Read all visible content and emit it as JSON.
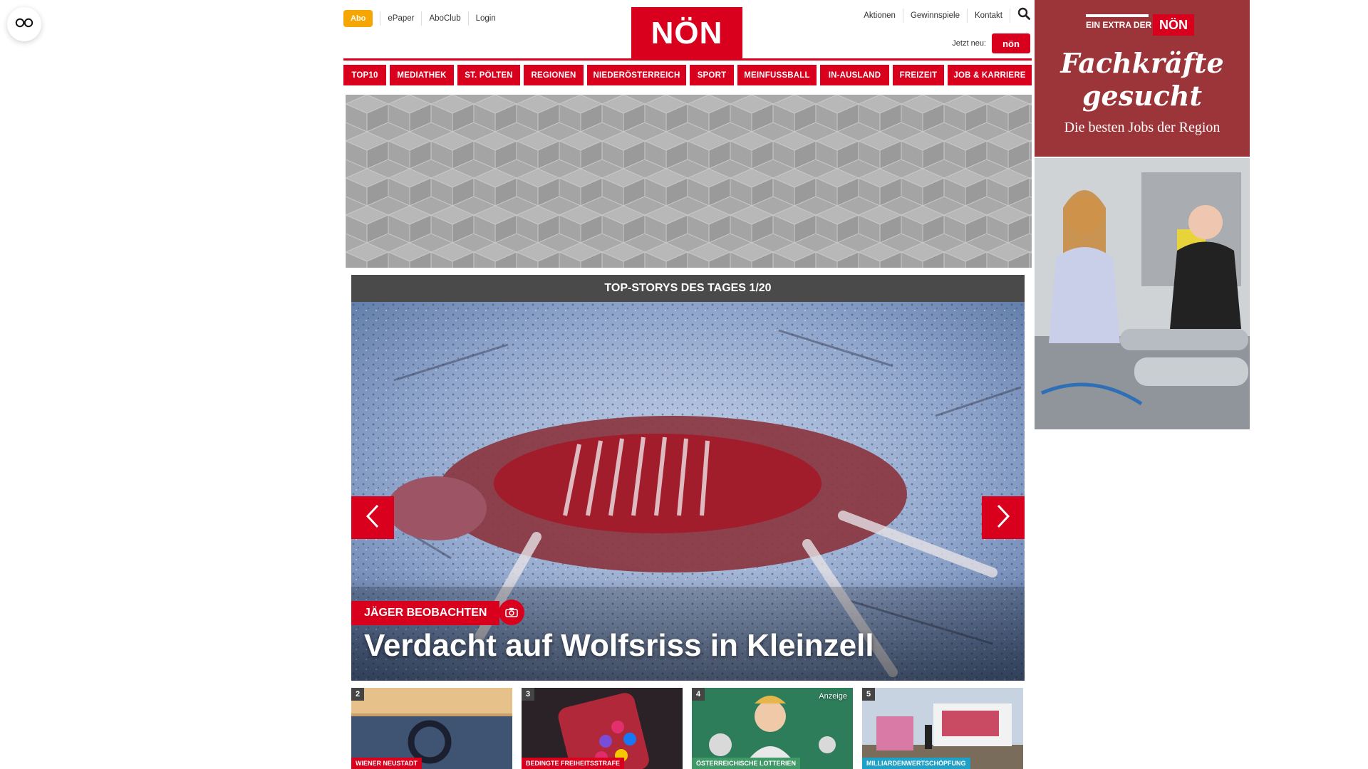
{
  "reader": {
    "icon": "glasses-icon"
  },
  "header": {
    "abo_label": "Abo",
    "left_links": [
      "ePaper",
      "AboClub",
      "Login"
    ],
    "logo_text": "NÖN",
    "right_links": [
      "Aktionen",
      "Gewinnspiele",
      "Kontakt"
    ],
    "search_icon": "search-icon",
    "jetzt_label": "Jetzt neu:",
    "mini_logo_text": "nön",
    "brand_color": "#d9001e",
    "abo_color": "#f5a600"
  },
  "mainnav": [
    "TOP10",
    "MEDIATHEK",
    "ST. PÖLTEN",
    "REGIONEN",
    "NIEDERÖSTERREICH",
    "SPORT",
    "MEINFUSSBALL",
    "IN-AUSLAND",
    "FREIZEIT",
    "JOB & KARRIERE"
  ],
  "slider": {
    "heading": "TOP-STORYS DES TAGES 1/20",
    "kicker": "JÄGER BEOBACHTEN",
    "headline": "Verdacht auf Wolfsriss in Kleinzell",
    "prev_icon": "chevron-left-icon",
    "next_icon": "chevron-right-icon",
    "camera_icon": "camera-icon"
  },
  "teasers": [
    {
      "num": "2",
      "tag": "WIENER NEUSTADT",
      "anzeige": ""
    },
    {
      "num": "3",
      "tag": "BEDINGTE FREIHEITSSTRAFE",
      "anzeige": ""
    },
    {
      "num": "4",
      "tag": "ÖSTERREICHISCHE LOTTERIEN",
      "anzeige": "Anzeige"
    },
    {
      "num": "5",
      "tag": "MILLIARDENWERTSCHÖPFUNG",
      "anzeige": ""
    }
  ],
  "sidead": {
    "extra": "EIN EXTRA DER",
    "logo": "NÖN",
    "title_line1": "Fachkräfte",
    "title_line2": "gesucht",
    "subtitle": "Die besten Jobs der Region"
  }
}
